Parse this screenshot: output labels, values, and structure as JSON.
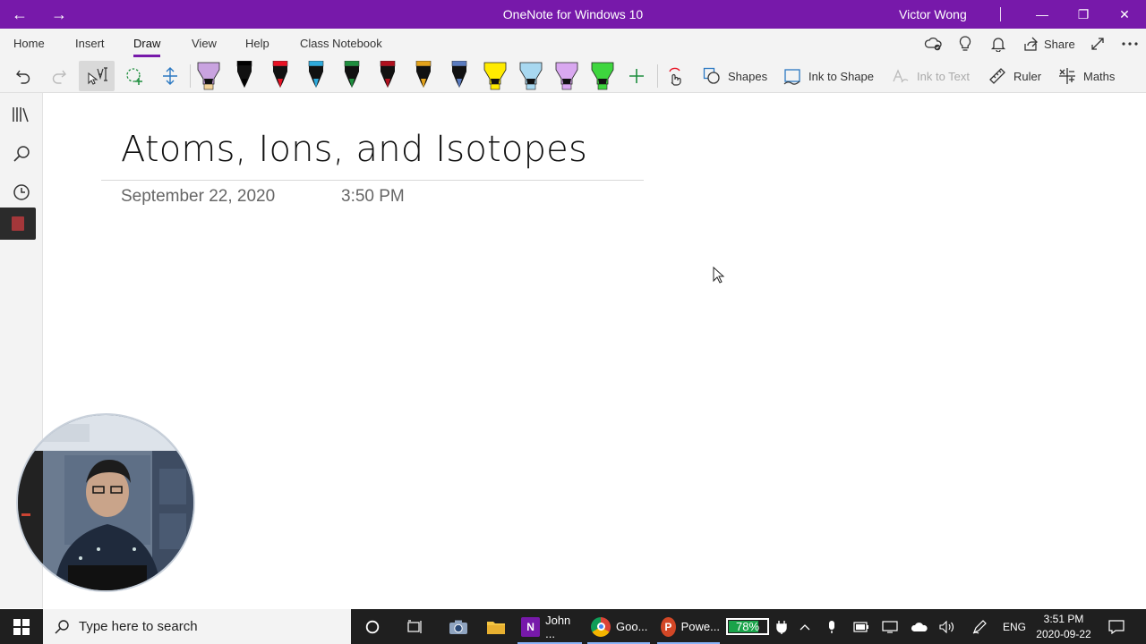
{
  "titlebar": {
    "title": "OneNote for Windows 10",
    "user": "Victor Wong",
    "back_glyph": "←",
    "forward_glyph": "→",
    "minimize_glyph": "—",
    "restore_glyph": "❐",
    "close_glyph": "✕",
    "color": "#7719aa"
  },
  "ribbon": {
    "tabs": [
      "Home",
      "Insert",
      "Draw",
      "View",
      "Help",
      "Class Notebook"
    ],
    "active_tab": "Draw",
    "share_label": "Share"
  },
  "toolbar": {
    "pens": [
      {
        "kind": "highlighter",
        "color": "#c9a3e0",
        "tip": "#f2d39b"
      },
      {
        "kind": "pen",
        "color": "#000000"
      },
      {
        "kind": "pen",
        "color": "#e81123"
      },
      {
        "kind": "pen",
        "color": "#2eaadc"
      },
      {
        "kind": "pen",
        "color": "#1e8e3e"
      },
      {
        "kind": "pen",
        "color": "#b0101e"
      },
      {
        "kind": "pen",
        "color": "#e3a21a"
      },
      {
        "kind": "pen",
        "color": "#5a7bbf"
      },
      {
        "kind": "highlighter",
        "color": "#ffeb00"
      },
      {
        "kind": "highlighter",
        "color": "#a8d8f0"
      },
      {
        "kind": "highlighter",
        "color": "#d9a8f0"
      },
      {
        "kind": "highlighter",
        "color": "#3ed63e"
      }
    ],
    "shapes_label": "Shapes",
    "ink_to_shape_label": "Ink to Shape",
    "ink_to_text_label": "Ink to Text",
    "ruler_label": "Ruler",
    "maths_label": "Maths"
  },
  "page": {
    "title": "Atoms, Ions, and Isotopes",
    "date": "September 22, 2020",
    "time": "3:50 PM"
  },
  "taskbar": {
    "search_placeholder": "Type here to search",
    "apps": [
      {
        "name": "onenote",
        "label": "John ...",
        "badge": "N",
        "color": "#7719aa"
      },
      {
        "name": "chrome",
        "label": "Goo...",
        "badge": "",
        "color": "#4285f4"
      },
      {
        "name": "powerpoint",
        "label": "Powe...",
        "badge": "P",
        "color": "#d24726"
      }
    ],
    "battery_percent": "78%",
    "battery_level": 0.78,
    "language": "ENG",
    "time": "3:51 PM",
    "date": "2020-09-22"
  }
}
